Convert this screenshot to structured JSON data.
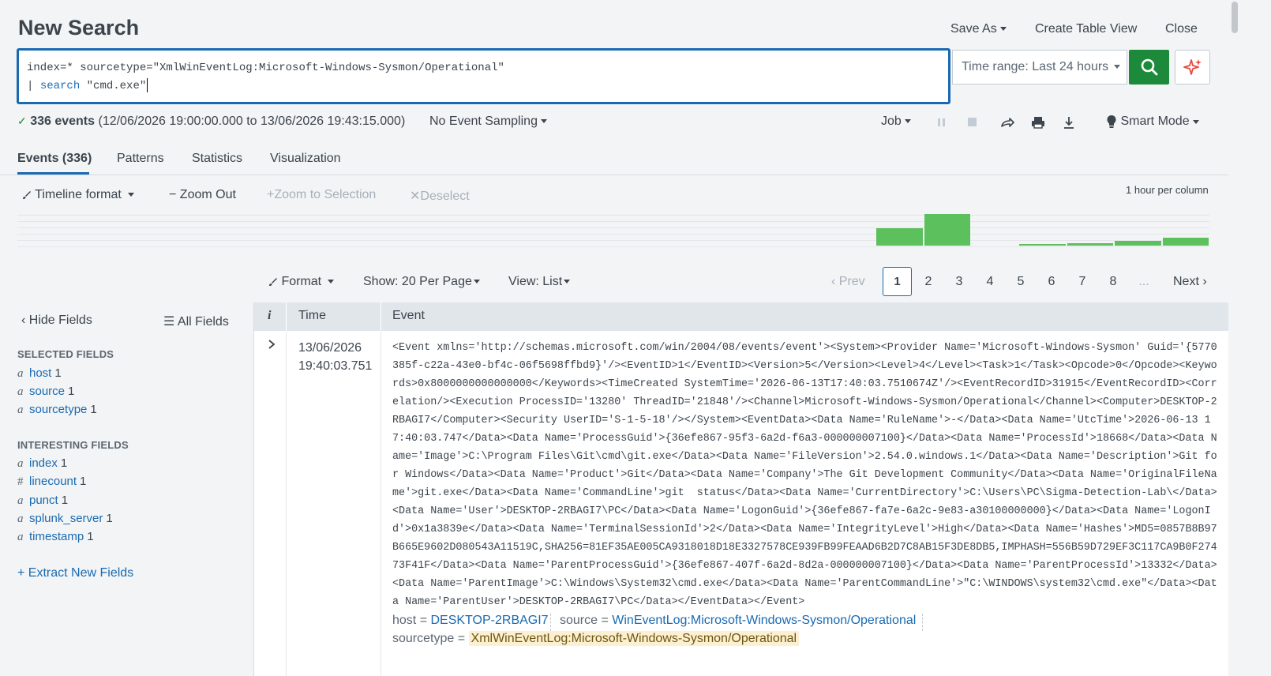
{
  "header": {
    "title": "New Search",
    "save_as": "Save As",
    "create_table_view": "Create Table View",
    "close": "Close"
  },
  "search": {
    "line1": "index=* sourcetype=\"XmlWinEventLog:Microsoft-Windows-Sysmon/Operational\"",
    "line2_pipe": "| ",
    "line2_cmd": "search",
    "line2_arg": " \"cmd.exe\"",
    "time_range": "Time range: Last 24 hours"
  },
  "status": {
    "count": "336 events",
    "range": "(12/06/2026 19:00:00.000 to 13/06/2026 19:43:15.000)",
    "sampling": "No Event Sampling",
    "job": "Job",
    "mode": "Smart Mode"
  },
  "tabs": [
    "Events (336)",
    "Patterns",
    "Statistics",
    "Visualization"
  ],
  "timeline": {
    "format": "Timeline format",
    "zoom_out": "Zoom Out",
    "zoom_selection": "Zoom to Selection",
    "deselect": "Deselect",
    "scale": "1 hour per column",
    "bars": [
      {
        "column": 18,
        "value": 0.55
      },
      {
        "column": 19,
        "value": 1.0
      },
      {
        "column": 21,
        "value": 0.05
      },
      {
        "column": 22,
        "value": 0.08
      },
      {
        "column": 23,
        "value": 0.14
      },
      {
        "column": 24,
        "value": 0.25
      }
    ],
    "columns": 25
  },
  "results": {
    "format": "Format",
    "per_page": "Show: 20 Per Page",
    "view": "View: List",
    "prev": "Prev",
    "next": "Next",
    "pages": [
      "1",
      "2",
      "3",
      "4",
      "5",
      "6",
      "7",
      "8",
      "..."
    ]
  },
  "fields": {
    "hide": "Hide Fields",
    "all": "All Fields",
    "selected_header": "SELECTED FIELDS",
    "selected": [
      {
        "type": "a",
        "name": "host",
        "count": "1"
      },
      {
        "type": "a",
        "name": "source",
        "count": "1"
      },
      {
        "type": "a",
        "name": "sourcetype",
        "count": "1"
      }
    ],
    "interesting_header": "INTERESTING FIELDS",
    "interesting": [
      {
        "type": "a",
        "name": "index",
        "count": "1"
      },
      {
        "type": "#",
        "name": "linecount",
        "count": "1"
      },
      {
        "type": "a",
        "name": "punct",
        "count": "1"
      },
      {
        "type": "a",
        "name": "splunk_server",
        "count": "1"
      },
      {
        "type": "a",
        "name": "timestamp",
        "count": "1"
      }
    ],
    "extract": "Extract New Fields"
  },
  "table": {
    "col_i": "i",
    "col_time": "Time",
    "col_event": "Event",
    "event": {
      "date": "13/06/2026",
      "time": "19:40:03.751",
      "raw": "<Event xmlns='http://schemas.microsoft.com/win/2004/08/events/event'><System><Provider Name='Microsoft-Windows-Sysmon' Guid='{5770385f-c22a-43e0-bf4c-06f5698ffbd9}'/><EventID>1</EventID><Version>5</Version><Level>4</Level><Task>1</Task><Opcode>0</Opcode><Keywords>0x8000000000000000</Keywords><TimeCreated SystemTime='2026-06-13T17:40:03.7510674Z'/><EventRecordID>31915</EventRecordID><Correlation/><Execution ProcessID='13280' ThreadID='21848'/><Channel>Microsoft-Windows-Sysmon/Operational</Channel><Computer>DESKTOP-2RBAGI7</Computer><Security UserID='S-1-5-18'/></System><EventData><Data Name='RuleName'>-</Data><Data Name='UtcTime'>2026-06-13 17:40:03.747</Data><Data Name='ProcessGuid'>{36efe867-95f3-6a2d-f6a3-000000007100}</Data><Data Name='ProcessId'>18668</Data><Data Name='Image'>C:\\Program Files\\Git\\cmd\\git.exe</Data><Data Name='FileVersion'>2.54.0.windows.1</Data><Data Name='Description'>Git for Windows</Data><Data Name='Product'>Git</Data><Data Name='Company'>The Git Development Community</Data><Data Name='OriginalFileName'>git.exe</Data><Data Name='CommandLine'>git  status</Data><Data Name='CurrentDirectory'>C:\\Users\\PC\\Sigma-Detection-Lab\\</Data><Data Name='User'>DESKTOP-2RBAGI7\\PC</Data><Data Name='LogonGuid'>{36efe867-fa7e-6a2c-9e83-a30100000000}</Data><Data Name='LogonId'>0x1a3839e</Data><Data Name='TerminalSessionId'>2</Data><Data Name='IntegrityLevel'>High</Data><Data Name='Hashes'>MD5=0857B8B97B665E9602D080543A11519C,SHA256=81EF35AE005CA9318018D18E3327578CE939FB99FEAAD6B2D7C8AB15F3DE8DB5,IMPHASH=556B59D729EF3C117CA9B0F27473F41F</Data><Data Name='ParentProcessGuid'>{36efe867-407f-6a2d-8d2a-000000007100}</Data><Data Name='ParentProcessId'>13332</Data><Data Name='ParentImage'>C:\\Windows\\System32\\cmd.exe</Data><Data Name='ParentCommandLine'>\"C:\\WINDOWS\\system32\\cmd.exe\"</Data><Data Name='ParentUser'>DESKTOP-2RBAGI7\\PC</Data></EventData></Event>",
      "host_key": "host =",
      "host_val": "DESKTOP-2RBAGI7",
      "source_key": "source =",
      "source_val": "WinEventLog:Microsoft-Windows-Sysmon/Operational",
      "sourcetype_key": "sourcetype =",
      "sourcetype_val": "XmlWinEventLog:Microsoft-Windows-Sysmon/Operational"
    }
  },
  "colors": {
    "accent": "#1a6ab1",
    "search_button": "#1c8a3a",
    "timeline_bar": "#5cc05c",
    "ai_sparkle": "#e8493f"
  }
}
